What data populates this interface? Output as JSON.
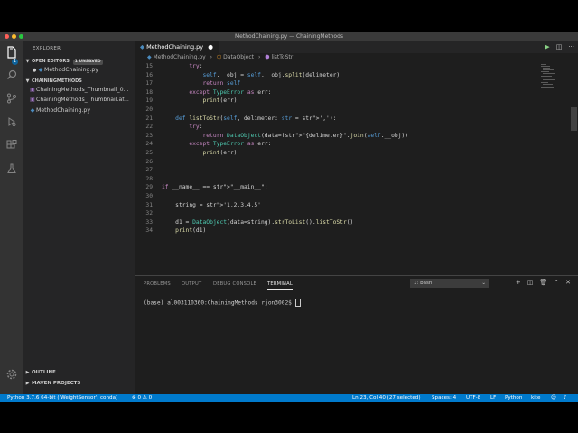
{
  "window": {
    "title": "MethodChaining.py — ChainingMethods"
  },
  "sidebar": {
    "title": "EXPLORER",
    "open_editors": {
      "label": "OPEN EDITORS",
      "badge": "1 UNSAVED",
      "files": [
        "MethodChaining.py"
      ]
    },
    "folder": {
      "label": "CHAININGMETHODS",
      "files": [
        "ChainingMethods_Thumbnail_0...",
        "ChainingMethods_Thumbnail.af...",
        "MethodChaining.py"
      ]
    },
    "outline": "OUTLINE",
    "maven": "MAVEN PROJECTS"
  },
  "activity_bar": {
    "explorer_badge": "1"
  },
  "editor": {
    "tab_label": "MethodChaining.py",
    "breadcrumb": [
      "MethodChaining.py",
      "DataObject",
      "listToStr"
    ],
    "lines": [
      {
        "n": "15",
        "text": "        try:"
      },
      {
        "n": "16",
        "text": "            self.__obj = self.__obj.split(delimeter)"
      },
      {
        "n": "17",
        "text": "            return self"
      },
      {
        "n": "18",
        "text": "        except TypeError as err:"
      },
      {
        "n": "19",
        "text": "            print(err)"
      },
      {
        "n": "20",
        "text": ""
      },
      {
        "n": "21",
        "text": "    def listToStr(self, delimeter: str = ','):"
      },
      {
        "n": "22",
        "text": "        try:"
      },
      {
        "n": "23",
        "text": "            return DataObject(data=f\"{delimeter}\".join(self.__obj))"
      },
      {
        "n": "24",
        "text": "        except TypeError as err:"
      },
      {
        "n": "25",
        "text": "            print(err)"
      },
      {
        "n": "26",
        "text": ""
      },
      {
        "n": "27",
        "text": ""
      },
      {
        "n": "28",
        "text": ""
      },
      {
        "n": "29",
        "text": "if __name__ == \"__main__\":"
      },
      {
        "n": "30",
        "text": ""
      },
      {
        "n": "31",
        "text": "    string = '1,2,3,4,5'"
      },
      {
        "n": "32",
        "text": ""
      },
      {
        "n": "33",
        "text": "    d1 = DataObject(data=string).strToList().listToStr()"
      },
      {
        "n": "34",
        "text": "    print(d1)"
      }
    ]
  },
  "panel": {
    "tabs": [
      "PROBLEMS",
      "OUTPUT",
      "DEBUG CONSOLE",
      "TERMINAL"
    ],
    "active_tab": "TERMINAL",
    "terminal_select": "1: bash",
    "prompt": "(base) al003110360:ChainingMethods rjon3002$ "
  },
  "statusbar": {
    "python": "Python 3.7.6 64-bit ('WeightSensor': conda)",
    "problems": "⊗ 0  ⚠ 0",
    "position": "Ln 23, Col 40 (27 selected)",
    "spaces": "Spaces: 4",
    "encoding": "UTF-8",
    "eol": "LF",
    "language": "Python",
    "extra": "kite"
  },
  "colors": {
    "accent": "#007acc",
    "editor_bg": "#1e1e1e",
    "sidebar_bg": "#252526",
    "activity_bg": "#333333"
  },
  "icons": [
    "files-icon",
    "search-icon",
    "source-control-icon",
    "debug-icon",
    "extensions-icon",
    "flask-icon",
    "gear-icon",
    "run-icon",
    "split-editor-icon",
    "more-icon"
  ]
}
